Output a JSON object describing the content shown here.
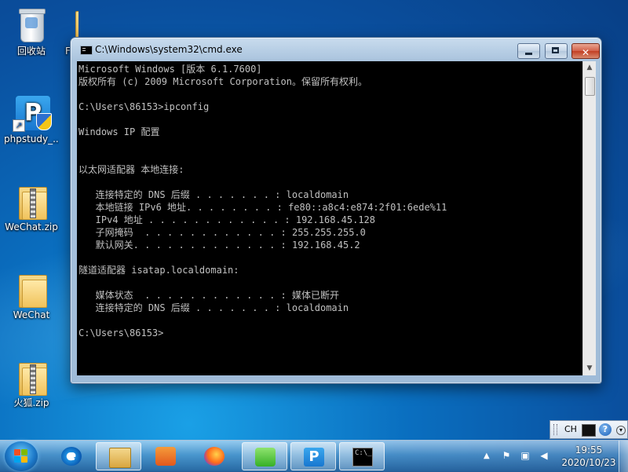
{
  "desktop": {
    "icons": [
      {
        "label": "回收站"
      },
      {
        "label": "F"
      },
      {
        "label": "phpstudy_..."
      },
      {
        "label": "WeChat.zip"
      },
      {
        "label": "WeChat"
      },
      {
        "label": "火狐.zip"
      }
    ]
  },
  "window": {
    "title": "C:\\Windows\\system32\\cmd.exe",
    "console_lines": [
      "Microsoft Windows [版本 6.1.7600]",
      "版权所有 (c) 2009 Microsoft Corporation。保留所有权利。",
      "",
      "C:\\Users\\86153>ipconfig",
      "",
      "Windows IP 配置",
      "",
      "",
      "以太网适配器 本地连接:",
      "",
      "   连接特定的 DNS 后缀 . . . . . . . : localdomain",
      "   本地链接 IPv6 地址. . . . . . . . : fe80::a8c4:e874:2f01:6ede%11",
      "   IPv4 地址 . . . . . . . . . . . . : 192.168.45.128",
      "   子网掩码  . . . . . . . . . . . . : 255.255.255.0",
      "   默认网关. . . . . . . . . . . . . : 192.168.45.2",
      "",
      "隧道适配器 isatap.localdomain:",
      "",
      "   媒体状态  . . . . . . . . . . . . : 媒体已断开",
      "   连接特定的 DNS 后缀 . . . . . . . : localdomain",
      "",
      "C:\\Users\\86153>"
    ]
  },
  "taskbar": {
    "items": [
      {
        "icon": "internet-explorer-icon"
      },
      {
        "icon": "windows-explorer-icon"
      },
      {
        "icon": "media-player-icon"
      },
      {
        "icon": "firefox-icon"
      },
      {
        "icon": "wechat-icon"
      },
      {
        "icon": "phpstudy-icon",
        "glyph": "P"
      },
      {
        "icon": "cmd-icon",
        "glyph": "C:\\_"
      }
    ],
    "language": "CH",
    "clock": {
      "time": "19:55",
      "date": "2020/10/23"
    }
  },
  "colors": {
    "console_bg": "#000000",
    "console_fg": "#c0c0c0",
    "close_button": "#c23e22"
  }
}
